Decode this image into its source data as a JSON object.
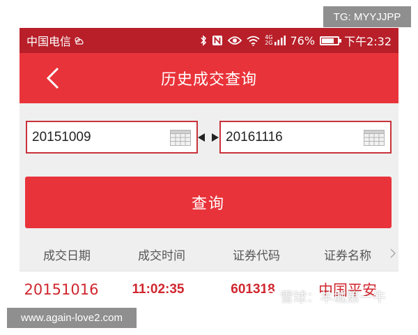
{
  "overlay": {
    "tg_tag": "TG: MYYJJPP",
    "site_watermark": "www.again-love2.com",
    "xueqiu_watermark": "雪球：羊城第一牛"
  },
  "status_bar": {
    "carrier": "中国电信",
    "network_label_top": "4G",
    "network_label_bottom": "2G",
    "battery": "76%",
    "battery_level": 0.76,
    "time": "下午2:32"
  },
  "header": {
    "title": "历史成交查询"
  },
  "query": {
    "start_date": "20151009",
    "end_date": "20161116",
    "button_label": "查询"
  },
  "table": {
    "columns": [
      "成交日期",
      "成交时间",
      "证券代码",
      "证券名称"
    ],
    "rows": [
      [
        "20151016",
        "11:02:35",
        "601318",
        "中国平安"
      ]
    ]
  },
  "colors": {
    "status_bar": "#b81f29",
    "header": "#e9333a",
    "accent_text": "#d0262e",
    "input_border": "#c9323b"
  }
}
